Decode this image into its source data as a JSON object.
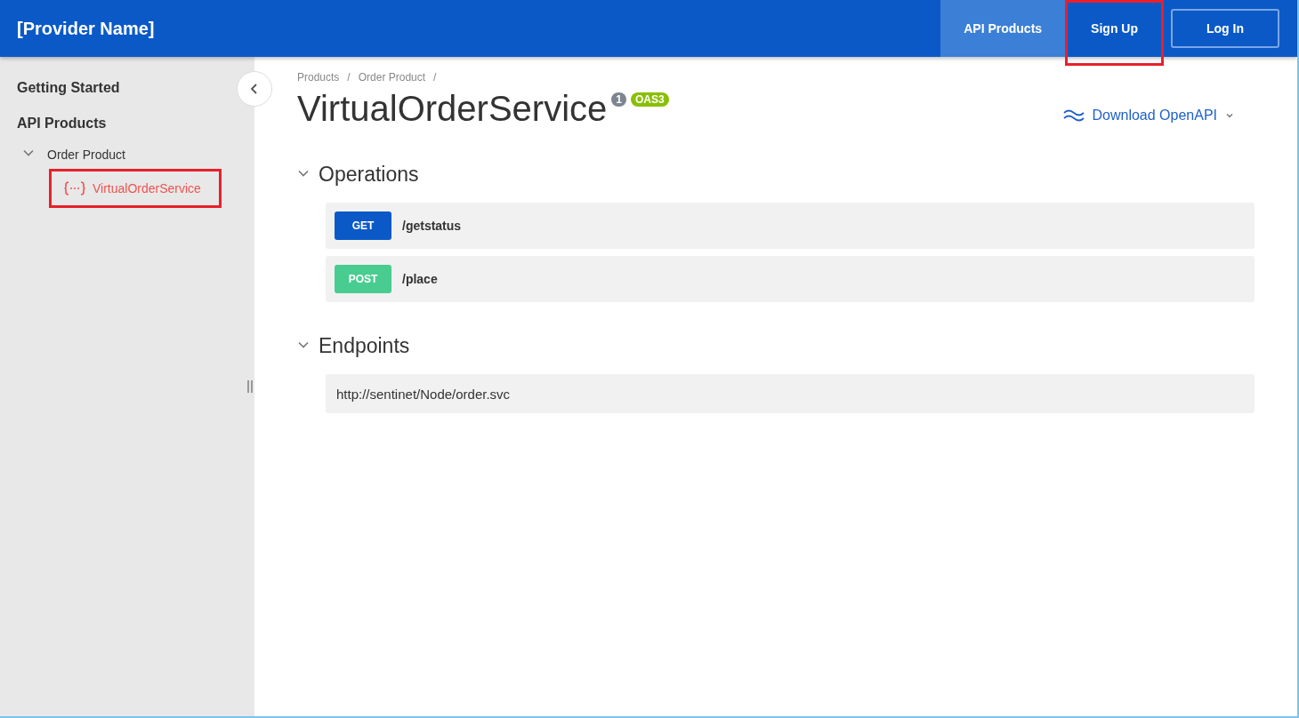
{
  "header": {
    "brand": "[Provider Name]",
    "nav": [
      {
        "label": "API Products",
        "selected": true,
        "highlighted": false,
        "kind": "tab"
      },
      {
        "label": "Sign Up",
        "selected": false,
        "highlighted": true,
        "kind": "tab"
      },
      {
        "label": "Log In",
        "selected": false,
        "highlighted": false,
        "kind": "outlined"
      }
    ]
  },
  "sidebar": {
    "sections": [
      {
        "label": "Getting Started"
      },
      {
        "label": "API Products",
        "children": [
          {
            "label": "Order Product",
            "expanded": true,
            "children": [
              {
                "label": "VirtualOrderService",
                "selected": true,
                "highlighted": true
              }
            ]
          }
        ]
      }
    ]
  },
  "breadcrumb": {
    "separator": "/",
    "items": [
      "Products",
      "Order Product"
    ]
  },
  "title": "VirtualOrderService",
  "version_badge": "1",
  "spec_badge": "OAS3",
  "download": "Download OpenAPI",
  "operations": {
    "title": "Operations",
    "expanded": true,
    "items": [
      {
        "method": "GET",
        "kind": "get",
        "path": "/getstatus"
      },
      {
        "method": "POST",
        "kind": "post",
        "path": "/place"
      }
    ]
  },
  "endpoints": {
    "title": "Endpoints",
    "expanded": true,
    "items": [
      "http://sentinet/Node/order.svc"
    ]
  }
}
